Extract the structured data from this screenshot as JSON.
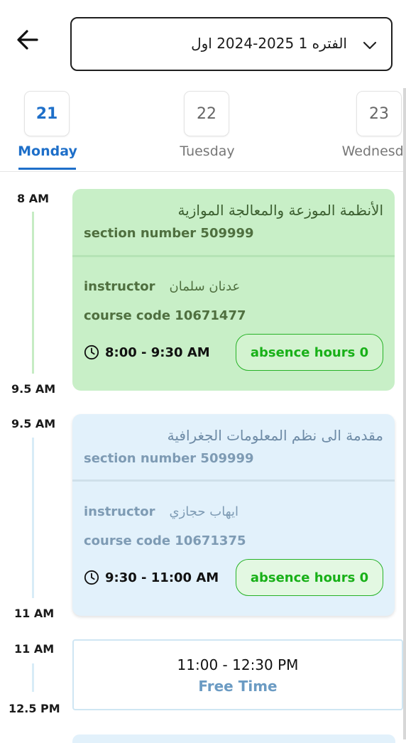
{
  "header": {
    "back_icon": "arrow-left-icon",
    "term_select": {
      "value": "الفتره 1   2025-2024 اول",
      "dropdown_icon": "chevron-down-icon"
    }
  },
  "days": [
    {
      "number": "21",
      "name": "Monday",
      "active": true
    },
    {
      "number": "22",
      "name": "Tuesday",
      "active": false
    },
    {
      "number": "23",
      "name": "Wednesda",
      "active": false
    }
  ],
  "colors": {
    "accent": "#1e6fc9",
    "card_green": "#c8efc7",
    "card_blue": "#e2f1fb",
    "absence_green": "#18b018",
    "free_time_blue": "#6b9bc3"
  },
  "schedule": [
    {
      "start_label": "8 AM",
      "end_label": "9.5 AM",
      "course_name": "الأنظمة الموزعة والمعالجة الموازية",
      "section": "section number 509999",
      "instructor_label": "instructor",
      "instructor_name": "عدنان سلمان",
      "course_code": "course code 10671477",
      "time": "8:00 - 9:30  AM",
      "absence": "absence hours 0"
    },
    {
      "start_label": "9.5 AM",
      "end_label": "11 AM",
      "course_name": "مقدمة الى نظم المعلومات الجغرافية",
      "section": "section number 509999",
      "instructor_label": "instructor",
      "instructor_name": "ايهاب حجازي",
      "course_code": "course code 10671375",
      "time": "9:30 - 11:00  AM",
      "absence": "absence hours 0"
    }
  ],
  "free_slot": {
    "start_label": "11 AM",
    "end_label": "12.5 PM",
    "time": "11:00 - 12:30 PM",
    "label": "Free Time"
  }
}
